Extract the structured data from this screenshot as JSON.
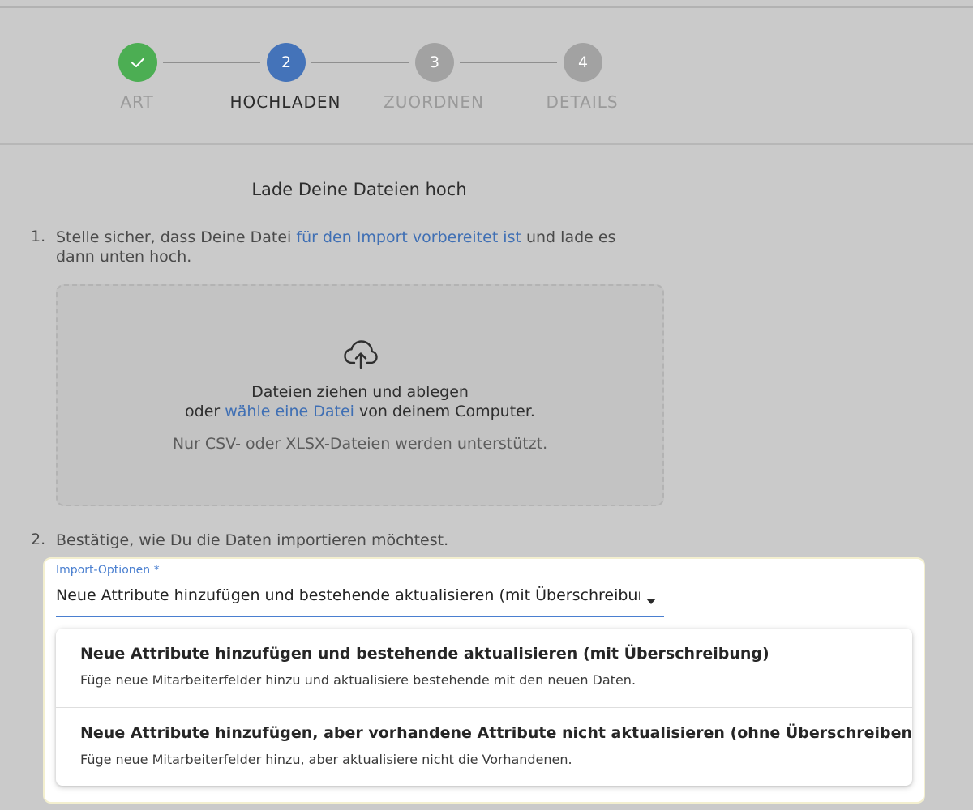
{
  "stepper": {
    "steps": [
      {
        "number": "",
        "label": "ART",
        "state": "completed",
        "icon": "check-icon"
      },
      {
        "number": "2",
        "label": "HOCHLADEN",
        "state": "active"
      },
      {
        "number": "3",
        "label": "ZUORDNEN",
        "state": "upcoming"
      },
      {
        "number": "4",
        "label": "DETAILS",
        "state": "upcoming"
      }
    ]
  },
  "colors": {
    "completed": "#4cae53",
    "active": "#4473b9",
    "upcoming": "#a2a2a2",
    "link": "#3f6fb4",
    "field_accent": "#4a7fd0"
  },
  "upload": {
    "title": "Lade Deine Dateien hoch",
    "step1": {
      "number": "1.",
      "text_before": "Stelle sicher, dass Deine Datei ",
      "link": "für den Import vorbereitet ist",
      "text_after": " und lade es dann unten hoch."
    },
    "dropzone": {
      "icon": "cloud-upload-icon",
      "line1": "Dateien ziehen und ablegen",
      "line2_before": "oder ",
      "line2_link": "wähle eine Datei",
      "line2_after": " von deinem Computer.",
      "hint": "Nur CSV- oder XLSX-Dateien werden unterstützt."
    },
    "step2": {
      "number": "2.",
      "text": "Bestätige, wie Du die Daten importieren möchtest."
    }
  },
  "import_options": {
    "label": "Import-Optionen *",
    "selected": "Neue Attribute hinzufügen und bestehende aktualisieren (mit Überschreibung)",
    "options": [
      {
        "title": "Neue Attribute hinzufügen und bestehende aktualisieren (mit Überschreibung)",
        "description": "Füge neue Mitarbeiterfelder hinzu und aktualisiere bestehende mit den neuen Daten."
      },
      {
        "title": "Neue Attribute hinzufügen, aber vorhandene Attribute nicht aktualisieren (ohne Überschreiben)",
        "description": "Füge neue Mitarbeiterfelder hinzu, aber aktualisiere nicht die Vorhandenen."
      }
    ]
  }
}
